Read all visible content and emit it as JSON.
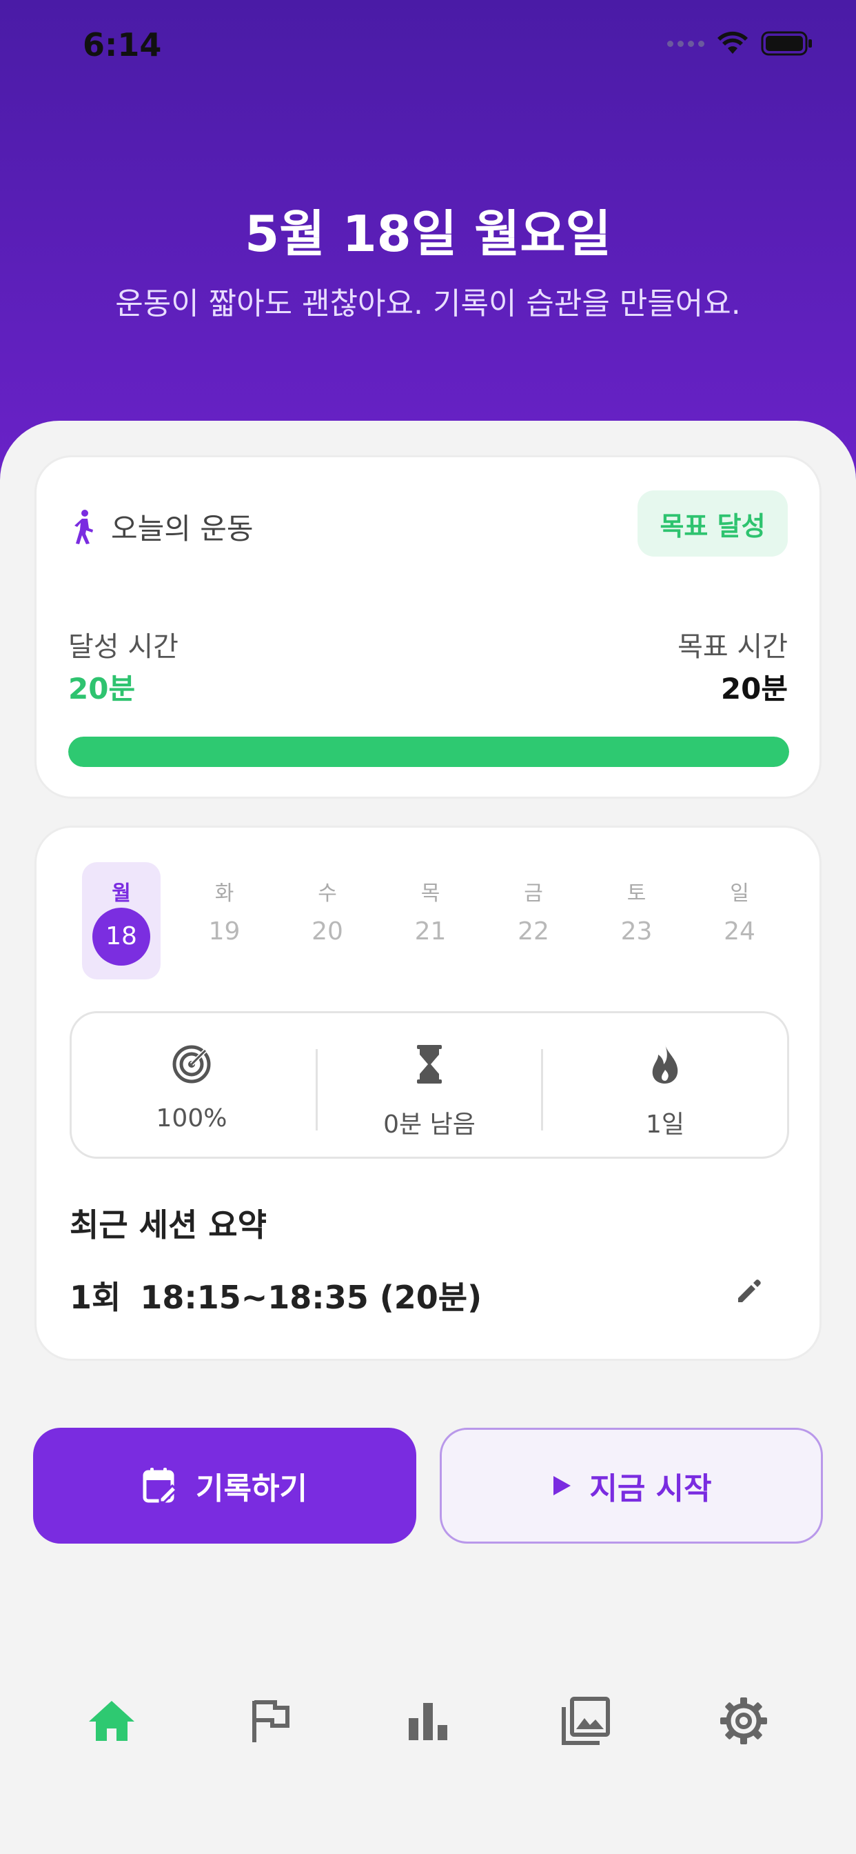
{
  "status": {
    "time": "6:14"
  },
  "header": {
    "title": "5월 18일 월요일",
    "subtitle": "운동이 짧아도 괜찮아요. 기록이 습관을 만들어요."
  },
  "today": {
    "title": "오늘의 운동",
    "badge": "목표 달성",
    "achieved_label": "달성 시간",
    "achieved_value": "20분",
    "goal_label": "목표 시간",
    "goal_value": "20분",
    "progress_fraction": 1.0
  },
  "week": {
    "days": [
      {
        "label": "월",
        "num": "18",
        "active": true
      },
      {
        "label": "화",
        "num": "19",
        "active": false
      },
      {
        "label": "수",
        "num": "20",
        "active": false
      },
      {
        "label": "목",
        "num": "21",
        "active": false
      },
      {
        "label": "금",
        "num": "22",
        "active": false
      },
      {
        "label": "토",
        "num": "23",
        "active": false
      },
      {
        "label": "일",
        "num": "24",
        "active": false
      }
    ]
  },
  "stats": {
    "rate": "100%",
    "remaining": "0분 남음",
    "streak": "1일"
  },
  "recent": {
    "title": "최근 세션 요약",
    "count": "1회",
    "range": "18:15~18:35 (20분)"
  },
  "actions": {
    "record_label": "기록하기",
    "start_label": "지금 시작"
  },
  "tabs": [
    "home-icon",
    "flag-icon",
    "bar-chart-icon",
    "gallery-icon",
    "settings-icon"
  ],
  "colors": {
    "accent": "#7a2ce0",
    "success": "#2ec971",
    "header_top": "#4a1ba6",
    "header_bottom": "#6a22c8"
  }
}
